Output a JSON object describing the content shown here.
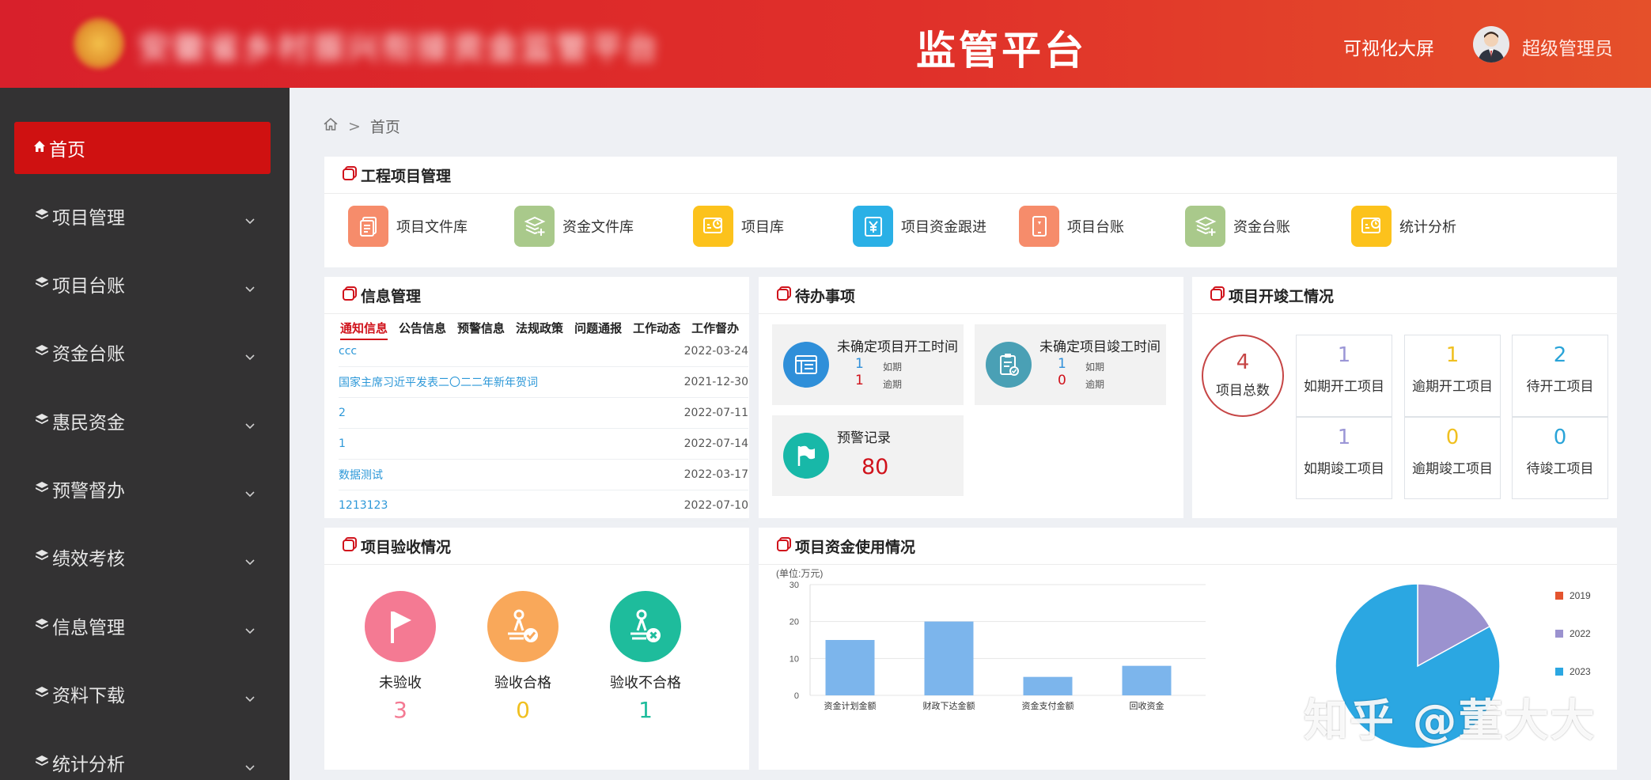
{
  "header": {
    "blurred_title": "安徽省乡村振兴衔接资金监管平台",
    "platform_title": "监管平台",
    "bigscreen_link": "可视化大屏",
    "user_name": "超级管理员"
  },
  "sidebar": {
    "items": [
      {
        "label": "首页",
        "icon": "home-icon"
      },
      {
        "label": "项目管理",
        "icon": "layers-icon"
      },
      {
        "label": "项目台账",
        "icon": "layers-icon"
      },
      {
        "label": "资金台账",
        "icon": "layers-icon"
      },
      {
        "label": "惠民资金",
        "icon": "layers-icon"
      },
      {
        "label": "预警督办",
        "icon": "layers-icon"
      },
      {
        "label": "绩效考核",
        "icon": "layers-icon"
      },
      {
        "label": "信息管理",
        "icon": "layers-icon"
      },
      {
        "label": "资料下载",
        "icon": "layers-icon"
      },
      {
        "label": "统计分析",
        "icon": "layers-icon"
      }
    ]
  },
  "breadcrumb": {
    "current": "首页"
  },
  "project_management": {
    "title": "工程项目管理",
    "items": [
      {
        "label": "项目文件库",
        "icon": "document-library-icon",
        "color": "#f68c6b"
      },
      {
        "label": "资金文件库",
        "icon": "stack-add-icon",
        "color": "#a9c98b"
      },
      {
        "label": "项目库",
        "icon": "chart-clock-icon",
        "color": "#fcc21c"
      },
      {
        "label": "项目资金跟进",
        "icon": "yen-receipt-icon",
        "color": "#2ab0e6"
      },
      {
        "label": "项目台账",
        "icon": "tablet-icon",
        "color": "#f68c6b"
      },
      {
        "label": "资金台账",
        "icon": "stack-add-icon",
        "color": "#a9c98b"
      },
      {
        "label": "统计分析",
        "icon": "chart-clock-icon",
        "color": "#fcc21c"
      }
    ]
  },
  "info_management": {
    "title": "信息管理",
    "tabs": [
      "通知信息",
      "公告信息",
      "预警信息",
      "法规政策",
      "问题通报",
      "工作动态",
      "工作督办"
    ],
    "rows": [
      {
        "title": "ccc",
        "date": "2022-03-24"
      },
      {
        "title": "国家主席习近平发表二〇二二年新年贺词",
        "date": "2021-12-30"
      },
      {
        "title": "2",
        "date": "2022-07-11"
      },
      {
        "title": "1",
        "date": "2022-07-14"
      },
      {
        "title": "数据测试",
        "date": "2022-03-17"
      },
      {
        "title": "1213123",
        "date": "2022-07-10"
      }
    ]
  },
  "todo": {
    "title": "待办事项",
    "start_time": {
      "title": "未确定项目开工时间",
      "ontime_value": "1",
      "ontime_label": "如期",
      "overdue_value": "1",
      "overdue_label": "逾期"
    },
    "finish_time": {
      "title": "未确定项目竣工时间",
      "ontime_value": "1",
      "ontime_label": "如期",
      "overdue_value": "0",
      "overdue_label": "逾期"
    },
    "warning": {
      "title": "预警记录",
      "value": "80"
    }
  },
  "start_finish": {
    "title": "项目开竣工情况",
    "total_value": "4",
    "total_label": "项目总数",
    "cells": [
      {
        "value": "1",
        "label": "如期开工项目",
        "color": "#9b96d6"
      },
      {
        "value": "1",
        "label": "逾期开工项目",
        "color": "#f0c020"
      },
      {
        "value": "2",
        "label": "待开工项目",
        "color": "#2aa4d8"
      },
      {
        "value": "1",
        "label": "如期竣工项目",
        "color": "#9b96d6"
      },
      {
        "value": "0",
        "label": "逾期竣工项目",
        "color": "#f0c020"
      },
      {
        "value": "0",
        "label": "待竣工项目",
        "color": "#2aa4d8"
      }
    ]
  },
  "acceptance": {
    "title": "项目验收情况",
    "items": [
      {
        "label": "未验收",
        "value": "3",
        "color": "#f47a93",
        "icon": "flag-icon"
      },
      {
        "label": "验收合格",
        "value": "0",
        "color": "#f9a85a",
        "icon": "stamp-check-icon"
      },
      {
        "label": "验收不合格",
        "value": "1",
        "color": "#1ebc9c",
        "icon": "stamp-cross-icon"
      }
    ]
  },
  "fund_usage": {
    "title": "项目资金使用情况"
  },
  "chart_data": [
    {
      "type": "bar",
      "title": "",
      "unit_label": "(单位:万元)",
      "categories": [
        "资金计划金额",
        "财政下达金额",
        "资金支付金额",
        "回收资金"
      ],
      "values": [
        15,
        20,
        5,
        8
      ],
      "ylim": [
        0,
        30
      ],
      "yticks": [
        0,
        10,
        20,
        30
      ],
      "grid": true,
      "bar_color": "#7cb5ec"
    },
    {
      "type": "pie",
      "slices": [
        {
          "label": "2019",
          "value": 0,
          "color": "#e4542f"
        },
        {
          "label": "2022",
          "value": 17,
          "color": "#9b92cf"
        },
        {
          "label": "2023",
          "value": 83,
          "color": "#2ba7e2"
        }
      ],
      "legend": "right"
    }
  ],
  "watermark": "知乎 @董大大"
}
